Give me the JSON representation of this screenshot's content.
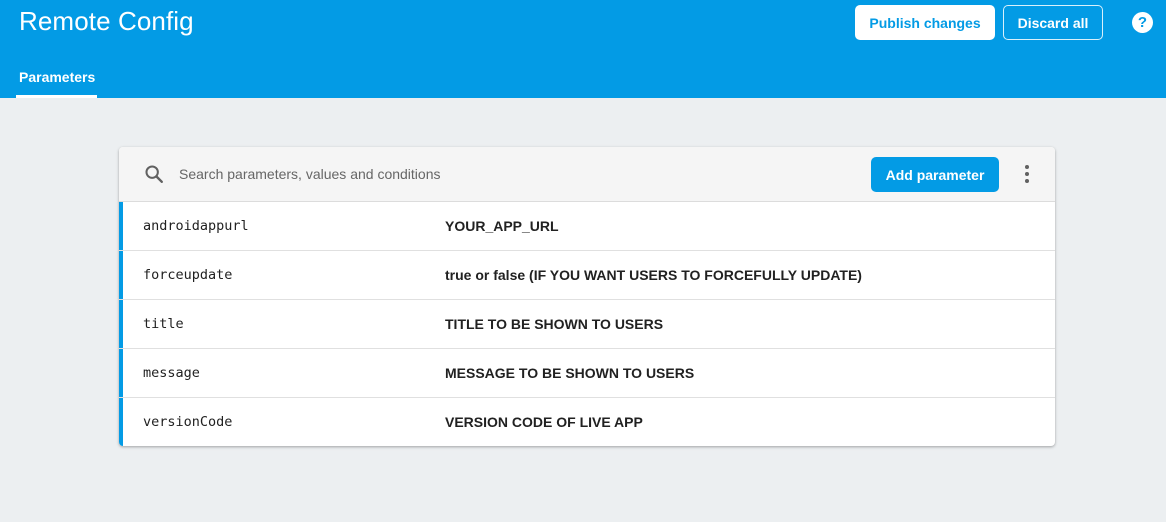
{
  "header": {
    "title": "Remote Config",
    "publish_label": "Publish changes",
    "discard_label": "Discard all",
    "help_label": "?"
  },
  "tabs": [
    {
      "label": "Parameters",
      "active": true
    }
  ],
  "toolbar": {
    "search_placeholder": "Search parameters, values and conditions",
    "search_value": "",
    "add_label": "Add parameter"
  },
  "parameters": [
    {
      "key": "androidappurl",
      "value": "YOUR_APP_URL"
    },
    {
      "key": "forceupdate",
      "value": "true or false (IF YOU WANT USERS TO FORCEFULLY UPDATE)"
    },
    {
      "key": "title",
      "value": "TITLE TO BE SHOWN TO USERS"
    },
    {
      "key": "message",
      "value": "MESSAGE TO BE SHOWN TO USERS"
    },
    {
      "key": "versionCode",
      "value": "VERSION CODE OF LIVE APP"
    }
  ],
  "colors": {
    "brand": "#039be5",
    "background": "#eceff1"
  },
  "icons": {
    "search": "search-icon",
    "more": "more-vert-icon",
    "help": "help-icon"
  }
}
